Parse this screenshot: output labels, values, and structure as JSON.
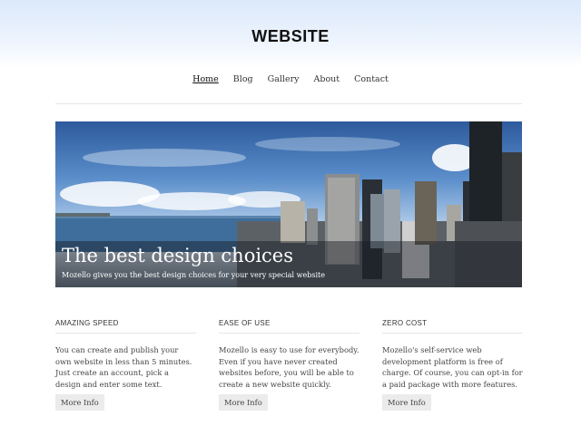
{
  "header": {
    "title": "WEBSITE"
  },
  "nav": {
    "items": [
      "Home",
      "Blog",
      "Gallery",
      "About",
      "Contact"
    ],
    "active": "Home"
  },
  "hero": {
    "title": "The best design choices",
    "subtitle": "Mozello gives you the best design choices for your very special website"
  },
  "features": [
    {
      "heading": "AMAZING SPEED",
      "text": "You can create and publish your own website in less than 5 minutes. Just create an account, pick a design and enter some text.",
      "button": "More Info"
    },
    {
      "heading": "EASE OF USE",
      "text": "Mozello is easy to use for everybody. Even if you have never created websites before, you will be able to create a new website quickly.",
      "button": "More Info"
    },
    {
      "heading": "ZERO COST",
      "text": "Mozello's self-service web development platform is free of charge. Of course, you can opt-in for a paid package with more features.",
      "button": "More Info"
    }
  ],
  "colors": {
    "header_gradient": "#dbe9fb",
    "button_bg": "#ebebeb",
    "text": "#444444"
  }
}
